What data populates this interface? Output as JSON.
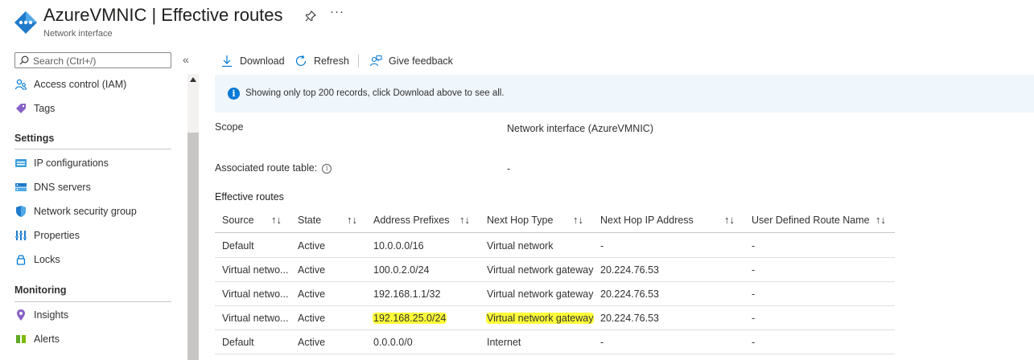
{
  "header": {
    "title": "AzureVMNIC | Effective routes",
    "subtitle": "Network interface",
    "more": "···"
  },
  "sidebar": {
    "search_placeholder": "Search (Ctrl+/)",
    "collapse": "«",
    "items_top": [
      {
        "label": "Access control (IAM)",
        "icon": "people-icon"
      },
      {
        "label": "Tags",
        "icon": "tag-icon"
      }
    ],
    "settings_heading": "Settings",
    "settings_items": [
      {
        "label": "IP configurations",
        "icon": "ip-config-icon"
      },
      {
        "label": "DNS servers",
        "icon": "dns-icon"
      },
      {
        "label": "Network security group",
        "icon": "shield-icon"
      },
      {
        "label": "Properties",
        "icon": "properties-icon"
      },
      {
        "label": "Locks",
        "icon": "lock-icon"
      }
    ],
    "monitoring_heading": "Monitoring",
    "monitoring_items": [
      {
        "label": "Insights",
        "icon": "insights-icon"
      },
      {
        "label": "Alerts",
        "icon": "alerts-icon"
      }
    ]
  },
  "toolbar": {
    "download": "Download",
    "refresh": "Refresh",
    "feedback": "Give feedback"
  },
  "banner": {
    "text": "Showing only top 200 records, click Download above to see all."
  },
  "details": {
    "scope_label": "Scope",
    "scope_value": "Network interface (AzureVMNIC)",
    "route_table_label": "Associated route table:",
    "route_table_value": "-",
    "section_title": "Effective routes"
  },
  "table": {
    "columns": [
      "Source",
      "State",
      "Address Prefixes",
      "Next Hop Type",
      "Next Hop IP Address",
      "User Defined Route Name"
    ],
    "sort_glyph": "↑↓",
    "rows": [
      [
        "Default",
        "Active",
        "10.0.0.0/16",
        "Virtual network",
        "-",
        "-"
      ],
      [
        "Virtual netwo...",
        "Active",
        "100.0.2.0/24",
        "Virtual network gateway",
        "20.224.76.53",
        "-"
      ],
      [
        "Virtual netwo...",
        "Active",
        "192.168.1.1/32",
        "Virtual network gateway",
        "20.224.76.53",
        "-"
      ],
      [
        "Virtual netwo...",
        "Active",
        "192.168.25.0/24",
        "Virtual network gateway",
        "20.224.76.53",
        "-"
      ],
      [
        "Default",
        "Active",
        "0.0.0.0/0",
        "Internet",
        "-",
        "-"
      ]
    ],
    "highlight_color": "#ffff3a"
  },
  "colors": {
    "accent": "#0078d4",
    "banner_bg": "#eff6fc"
  }
}
